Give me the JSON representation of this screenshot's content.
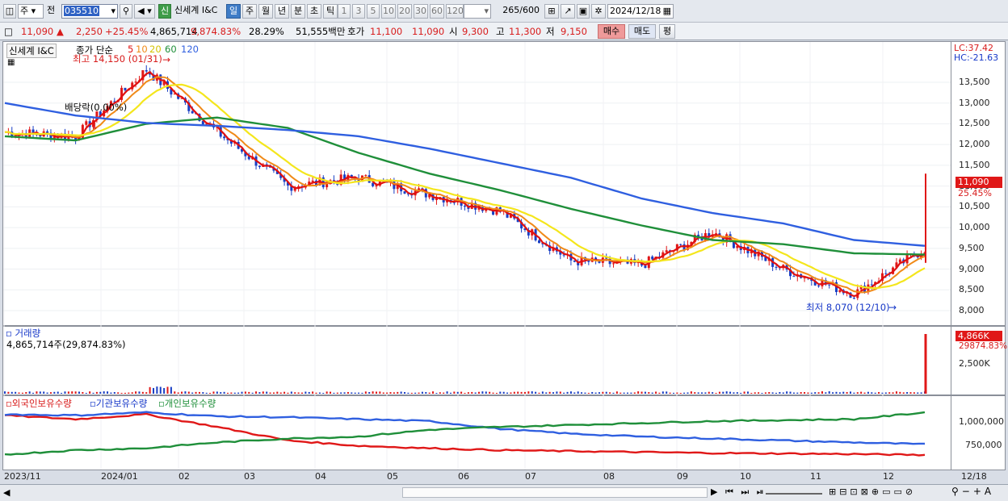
{
  "toolbar": {
    "period_type": "주",
    "market": "전",
    "code": "035510",
    "stock_badge": "신",
    "stock_name": "신세계 I&C",
    "tf_buttons": [
      "일",
      "주",
      "월",
      "년",
      "분",
      "초",
      "틱"
    ],
    "tf_selected": "일",
    "num_buttons": [
      "1",
      "3",
      "5",
      "10",
      "20",
      "30",
      "60",
      "120"
    ],
    "count": "265",
    "count_total": "/600",
    "date": "2024/12/18"
  },
  "quote": {
    "price": "11,090",
    "change_arrow": "▲",
    "change": "2,250",
    "change_pct": "+25.45%",
    "volume": "4,865,714",
    "vol_ratio": "9,874.83%",
    "turnover": "28.29%",
    "amount": "51,555백만",
    "ask_label": "호가",
    "ask": "11,100",
    "bid": "11,090",
    "open_label": "시",
    "open": "9,300",
    "high_label": "고",
    "high": "11,300",
    "low_label": "저",
    "low": "9,150",
    "buy_label": "매수",
    "sell_label": "매도",
    "eval_label": "평"
  },
  "price_pane": {
    "title": "신세계 I&C",
    "legend_prefix": "종가 단순",
    "ma_periods": [
      "5",
      "10",
      "20",
      "60",
      "120"
    ],
    "high_note": "최고 14,150 (01/31)",
    "low_note": "최저 8,070 (12/10)",
    "dividend_note": "배당락(0.00%)",
    "lc": "LC:37.42",
    "hc": "HC:-21.63",
    "last_price": "11,090",
    "last_pct": "25.45%",
    "y_ticks": [
      "13,500",
      "13,000",
      "12,500",
      "12,000",
      "11,500",
      "11,000",
      "10,500",
      "10,000",
      "9,500",
      "9,000",
      "8,500",
      "8,000"
    ]
  },
  "volume_pane": {
    "title": "거래량",
    "value": "4,865,714주(29,874.83%)",
    "badge": "4,866K",
    "badge_pct": "29874.83%",
    "y_tick": "2,500K"
  },
  "holding_pane": {
    "legend": [
      "외국인보유수량",
      "기관보유수량",
      "개인보유수량"
    ],
    "y_ticks": [
      "1,000,000",
      "750,000"
    ]
  },
  "x_axis": [
    "2023/11",
    "2024/01",
    "02",
    "03",
    "04",
    "05",
    "06",
    "07",
    "08",
    "09",
    "10",
    "11",
    "12",
    "12/18"
  ],
  "colors": {
    "up": "#e01818",
    "down": "#1a3fc4",
    "ma5": "#e01010",
    "ma10": "#f08a18",
    "ma20": "#f4e61c",
    "ma60": "#1f8f3a",
    "ma120": "#2f5fe0"
  },
  "chart_data": [
    {
      "type": "line",
      "title": "신세계 I&C",
      "series": [
        {
          "name": "5",
          "x": [
            "2023/11",
            "2024/01",
            "02",
            "03",
            "04",
            "05",
            "06",
            "07",
            "08",
            "09",
            "10",
            "11",
            "12",
            "12/18"
          ],
          "values": [
            12300,
            12200,
            13800,
            12300,
            11000,
            11200,
            10800,
            10400,
            9200,
            9100,
            9900,
            9000,
            8400,
            9500
          ]
        },
        {
          "name": "60",
          "x": [
            "2023/11",
            "2024/01",
            "02",
            "03",
            "04",
            "05",
            "06",
            "07",
            "08",
            "09",
            "10",
            "11",
            "12",
            "12/18"
          ],
          "values": [
            12200,
            12100,
            12500,
            12650,
            12400,
            11800,
            11300,
            10900,
            10450,
            10050,
            9700,
            9600,
            9380,
            9350
          ]
        },
        {
          "name": "120",
          "x": [
            "2023/11",
            "2024/01",
            "02",
            "03",
            "04",
            "05",
            "06",
            "07",
            "08",
            "09",
            "10",
            "11",
            "12",
            "12/18"
          ],
          "values": [
            13000,
            12700,
            12520,
            12450,
            12350,
            12200,
            11900,
            11550,
            11200,
            10700,
            10350,
            10100,
            9700,
            9560
          ]
        }
      ],
      "ylim": [
        7900,
        14200
      ]
    },
    {
      "type": "bar",
      "title": "거래량",
      "categories": [
        "12/18"
      ],
      "values": [
        4865714
      ]
    },
    {
      "type": "line",
      "series": [
        {
          "name": "외국인보유수량",
          "x": [
            "2023/11",
            "2024/01",
            "02",
            "03",
            "04",
            "05",
            "06",
            "07",
            "08",
            "09",
            "10",
            "11",
            "12",
            "12/18"
          ],
          "values": [
            1060000,
            1020000,
            1070000,
            940000,
            800000,
            745000,
            720000,
            700000,
            690000,
            680000,
            670000,
            665000,
            660000,
            650000
          ]
        },
        {
          "name": "기관보유수량",
          "x": [
            "2023/11",
            "2024/01",
            "02",
            "03",
            "04",
            "05",
            "06",
            "07",
            "08",
            "09",
            "10",
            "11",
            "12",
            "12/18"
          ],
          "values": [
            1070000,
            1060000,
            1090000,
            1050000,
            1040000,
            1020000,
            1000000,
            920000,
            870000,
            840000,
            820000,
            800000,
            780000,
            760000
          ]
        },
        {
          "name": "개인보유수량",
          "x": [
            "2023/11",
            "2024/01",
            "02",
            "03",
            "04",
            "05",
            "06",
            "07",
            "08",
            "09",
            "10",
            "11",
            "12",
            "12/18"
          ],
          "values": [
            655000,
            700000,
            720000,
            780000,
            820000,
            840000,
            910000,
            940000,
            960000,
            980000,
            1000000,
            1010000,
            1020000,
            1090000
          ]
        }
      ]
    }
  ]
}
